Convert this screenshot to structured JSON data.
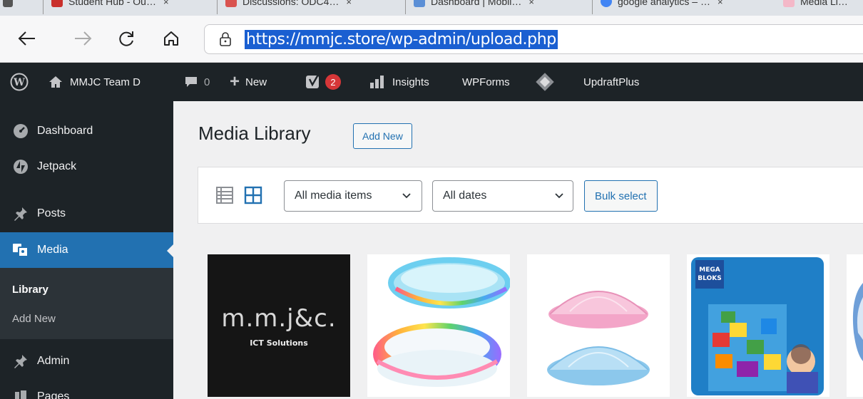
{
  "browser": {
    "tabs": [
      {
        "label": "Student Hub - Ou…",
        "favicon_color": "#c9302c"
      },
      {
        "label": "Discussions: ODC4…",
        "favicon_color": "#d9534f"
      },
      {
        "label": "Dashboard | Mobil…",
        "favicon_color": "#5b8fd6"
      },
      {
        "label": "google analytics – …",
        "favicon_color": "#4285f4"
      },
      {
        "label": "Media Li…",
        "favicon_color": "#f4b8c8"
      }
    ],
    "tab_close": "×",
    "url": "https://mmjc.store/wp-admin/upload.php"
  },
  "adminbar": {
    "site_name": "MMJC Team D",
    "comments_count": "0",
    "new_label": "New",
    "yoast_badge": "2",
    "insights_label": "Insights",
    "wpforms_label": "WPForms",
    "updraft_label": "UpdraftPlus"
  },
  "sidebar": {
    "items": [
      {
        "label": "Dashboard",
        "icon": "dashboard-icon"
      },
      {
        "label": "Jetpack",
        "icon": "jetpack-icon"
      },
      {
        "label": "Posts",
        "icon": "pin-icon"
      },
      {
        "label": "Media",
        "icon": "media-icon"
      },
      {
        "label": "Admin",
        "icon": "pin-icon"
      },
      {
        "label": "Pages",
        "icon": "pages-icon"
      }
    ],
    "submenu": [
      "Library",
      "Add New"
    ]
  },
  "main": {
    "title": "Media Library",
    "add_new": "Add New",
    "filter_type": "All media items",
    "filter_date": "All dates",
    "bulk_select": "Bulk select",
    "thumbnails": [
      {
        "name": "mmjc-logo",
        "logo_text": "m.m.j&c.",
        "logo_sub": "ICT Solutions"
      },
      {
        "name": "inflatable-pools"
      },
      {
        "name": "baby-mosquito-nets"
      },
      {
        "name": "mega-bloks-toy",
        "brand": "MEGA BLOKS"
      },
      {
        "name": "partial-product"
      }
    ]
  },
  "colors": {
    "accent": "#2271b1",
    "admin_bg": "#1d2327",
    "submenu_bg": "#2c3338",
    "url_highlight": "#1a5fd1"
  }
}
